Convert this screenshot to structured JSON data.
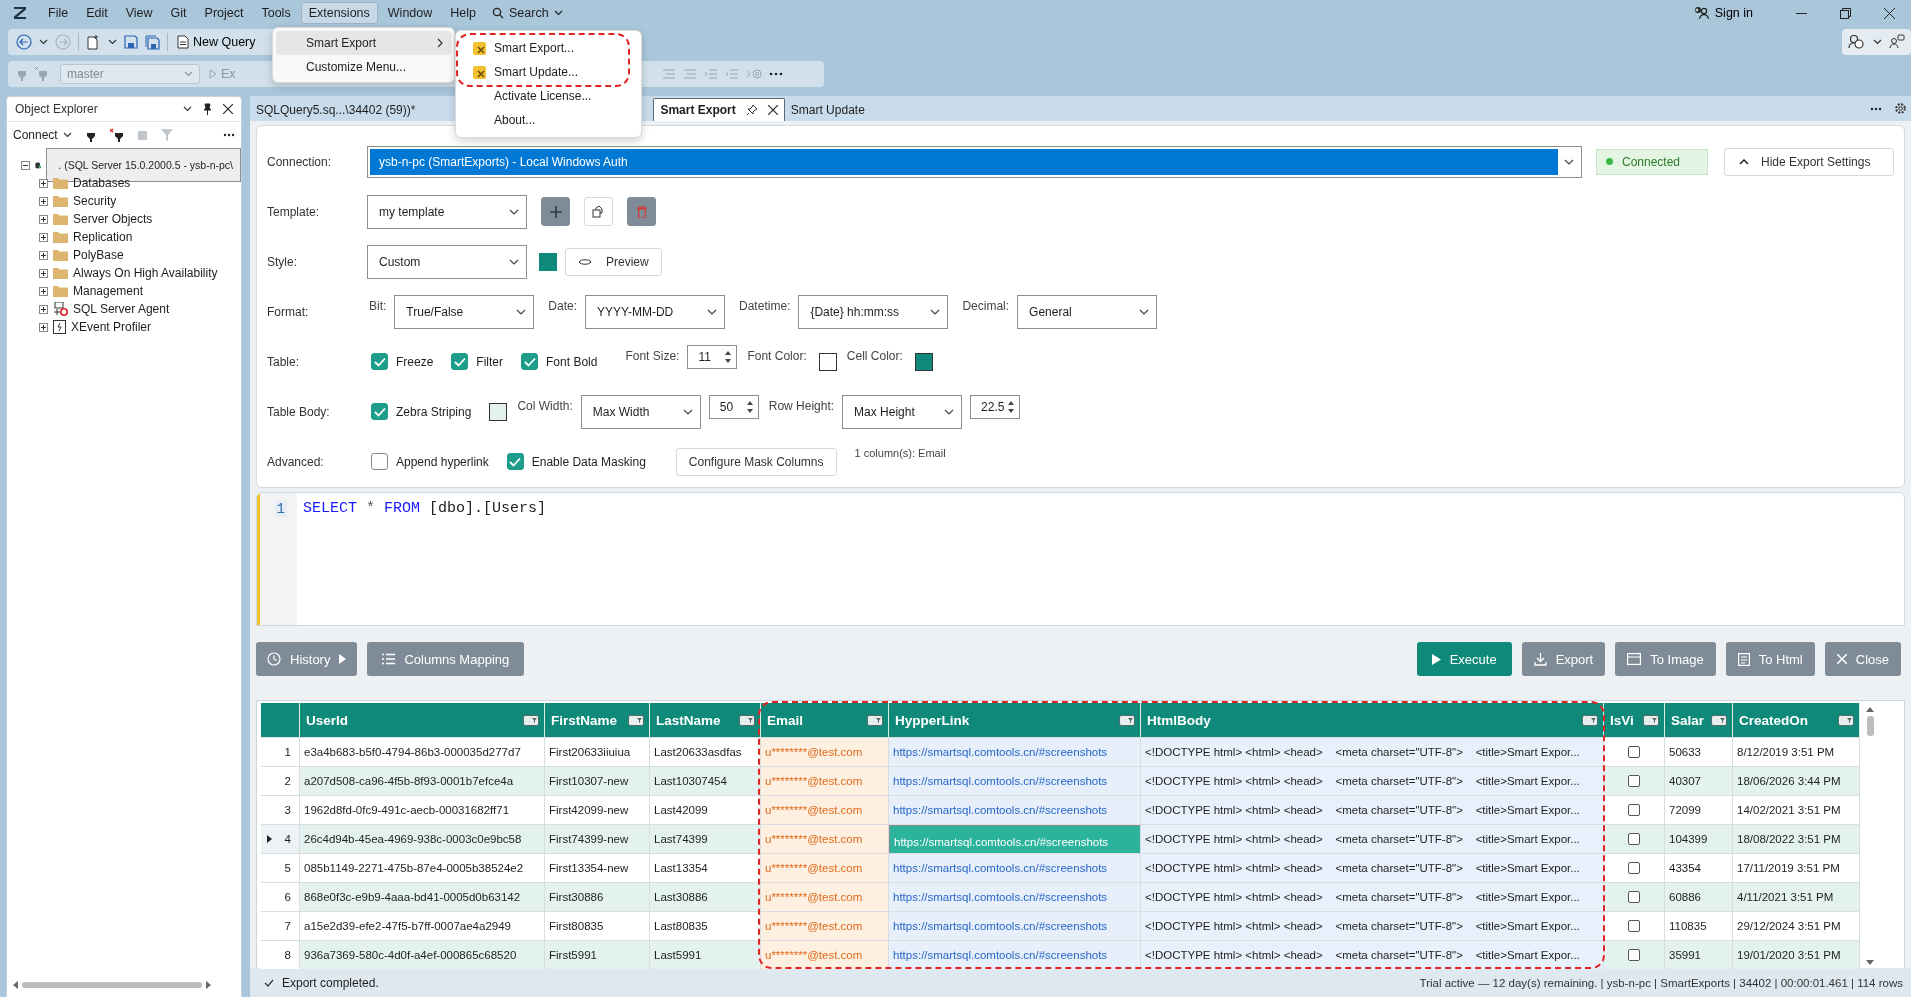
{
  "menu_bar": {
    "items": [
      {
        "label": "File",
        "selected": false
      },
      {
        "label": "Edit",
        "selected": false
      },
      {
        "label": "View",
        "selected": false
      },
      {
        "label": "Git",
        "selected": false
      },
      {
        "label": "Project",
        "selected": false
      },
      {
        "label": "Tools",
        "selected": false
      },
      {
        "label": "Extensions",
        "selected": true
      },
      {
        "label": "Window",
        "selected": false
      },
      {
        "label": "Help",
        "selected": false
      }
    ],
    "search": "Search",
    "sign_in": "Sign in"
  },
  "extensions_menu": {
    "items": [
      {
        "label": "Smart Export",
        "submenu": true,
        "selected": true
      },
      {
        "label": "Customize Menu...",
        "submenu": false,
        "selected": false
      }
    ]
  },
  "submenu": {
    "items": [
      {
        "label": "Smart Export...",
        "icon": true
      },
      {
        "label": "Smart Update...",
        "icon": true
      },
      {
        "label": "Activate License...",
        "icon": false
      },
      {
        "label": "About...",
        "icon": false
      }
    ]
  },
  "toolbar": {
    "new_query": "New Query",
    "database": "master",
    "execute": "Ex"
  },
  "object_explorer": {
    "title": "Object Explorer",
    "connect": "Connect",
    "tree": [
      {
        "label": ". (SQL Server 15.0.2000.5 - ysb-n-pc\\",
        "kind": "server",
        "selected": true,
        "expanded": true,
        "children": [
          {
            "label": "Databases",
            "kind": "folder",
            "selected": false,
            "expanded": false
          },
          {
            "label": "Security",
            "kind": "folder",
            "selected": false,
            "expanded": false
          },
          {
            "label": "Server Objects",
            "kind": "folder",
            "selected": false,
            "expanded": false
          },
          {
            "label": "Replication",
            "kind": "folder",
            "selected": false,
            "expanded": false
          },
          {
            "label": "PolyBase",
            "kind": "folder",
            "selected": false,
            "expanded": false
          },
          {
            "label": "Always On High Availability",
            "kind": "folder",
            "selected": false,
            "expanded": false
          },
          {
            "label": "Management",
            "kind": "folder",
            "selected": false,
            "expanded": false
          },
          {
            "label": "SQL Server Agent",
            "kind": "agent",
            "selected": false,
            "expanded": false
          },
          {
            "label": "XEvent Profiler",
            "kind": "profiler",
            "selected": false,
            "expanded": false
          }
        ]
      }
    ]
  },
  "doc_tabs": [
    {
      "label": "SQLQuery5.sq...\\34402 (59))*",
      "selected": false
    },
    {
      "label": "Smart Export",
      "selected": true
    },
    {
      "label": "Smart Update",
      "selected": false
    }
  ],
  "export_settings": {
    "connection": {
      "label": "Connection:",
      "value": "ysb-n-pc (SmartExports) - Local Windows Auth",
      "status": "Connected",
      "connected": true,
      "toggle": "Hide Export Settings"
    },
    "template": {
      "label": "Template:",
      "value": "my template"
    },
    "style": {
      "label": "Style:",
      "value": "Custom",
      "color": "#0f8a7a",
      "preview": "Preview"
    },
    "format": {
      "label": "Format:",
      "fields": [
        {
          "label": "Bit:",
          "value": "True/False"
        },
        {
          "label": "Date:",
          "value": "YYYY-MM-DD"
        },
        {
          "label": "Datetime:",
          "value": "{Date} hh:mm:ss"
        },
        {
          "label": "Decimal:",
          "value": "General"
        }
      ]
    },
    "table": {
      "label": "Table:",
      "options": [
        {
          "label": "Freeze",
          "checked": true
        },
        {
          "label": "Filter",
          "checked": true
        },
        {
          "label": "Font Bold",
          "checked": true
        }
      ],
      "font_size": {
        "label": "Font Size:",
        "value": "11"
      },
      "font_color": {
        "label": "Font Color:",
        "color": "#ffffff"
      },
      "cell_color": {
        "label": "Cell Color:",
        "color": "#0f8a7a"
      }
    },
    "table_body": {
      "label": "Table Body:",
      "zebra": {
        "label": "Zebra Striping",
        "checked": true,
        "color": "#e3f2ee"
      },
      "col_width": {
        "label": "Col Width:",
        "mode": "Max Width",
        "value": "50"
      },
      "row_height": {
        "label": "Row Height:",
        "mode": "Max Height",
        "value": "22.5"
      }
    },
    "advanced": {
      "label": "Advanced:",
      "options": [
        {
          "label": "Append hyperlink",
          "checked": false
        },
        {
          "label": "Enable Data Masking",
          "checked": true
        }
      ],
      "configure": "Configure Mask Columns",
      "note": "1 column(s): Email"
    }
  },
  "editor": {
    "line_numbers": [
      "1"
    ],
    "tokens": [
      {
        "text": "SELECT",
        "kind": "keyword"
      },
      {
        "text": " * ",
        "kind": "operator"
      },
      {
        "text": "FROM",
        "kind": "keyword"
      },
      {
        "text": " [dbo].[Users]",
        "kind": "plain"
      }
    ]
  },
  "left_actions": [
    {
      "label": "History",
      "kind": "history"
    },
    {
      "label": "Columns Mapping",
      "kind": "columns"
    }
  ],
  "right_actions": [
    {
      "label": "Execute",
      "kind": "execute"
    },
    {
      "label": "Export",
      "kind": "export"
    },
    {
      "label": "To Image",
      "kind": "image"
    },
    {
      "label": "To Html",
      "kind": "html"
    },
    {
      "label": "Close",
      "kind": "close"
    }
  ],
  "grid": {
    "columns": [
      {
        "label": "UserId",
        "kind": "text"
      },
      {
        "label": "FirstName",
        "kind": "text"
      },
      {
        "label": "LastName",
        "kind": "text"
      },
      {
        "label": "Email",
        "kind": "masked"
      },
      {
        "label": "HypperLink",
        "kind": "link"
      },
      {
        "label": "HtmlBody",
        "kind": "html"
      },
      {
        "label": "IsVi",
        "kind": "check"
      },
      {
        "label": "Salar",
        "kind": "text"
      },
      {
        "label": "CreatedOn",
        "kind": "text"
      }
    ],
    "rows": [
      {
        "number": "1",
        "current": false,
        "cells": [
          "e3a4b683-b5f0-4794-86b3-000035d277d7",
          "First20633iiuiua",
          "Last20633asdfas",
          "u********@test.com",
          "https://smartsql.comtools.cn/#screenshots",
          "<!DOCTYPE html> <html> <head>    <meta charset=\"UTF-8\">    <title>Smart Expor...",
          false,
          "50633",
          "8/12/2019 3:51 PM"
        ]
      },
      {
        "number": "2",
        "current": false,
        "cells": [
          "a207d508-ca96-4f5b-8f93-0001b7efce4a",
          "First10307-new",
          "Last10307454",
          "u********@test.com",
          "https://smartsql.comtools.cn/#screenshots",
          "<!DOCTYPE html> <html> <head>    <meta charset=\"UTF-8\">    <title>Smart Expor...",
          false,
          "40307",
          "18/06/2026 3:44 PM"
        ]
      },
      {
        "number": "3",
        "current": false,
        "cells": [
          "1962d8fd-0fc9-491c-aecb-00031682ff71",
          "First42099-new",
          "Last42099",
          "u********@test.com",
          "https://smartsql.comtools.cn/#screenshots",
          "<!DOCTYPE html> <html> <head>    <meta charset=\"UTF-8\">    <title>Smart Expor...",
          false,
          "72099",
          "14/02/2021 3:51 PM"
        ]
      },
      {
        "number": "4",
        "current": true,
        "cells": [
          "26c4d94b-45ea-4969-938c-0003c0e9bc58",
          "First74399-new",
          "Last74399",
          "u********@test.com",
          "https://smartsql.comtools.cn/#screenshots",
          "<!DOCTYPE html> <html> <head>    <meta charset=\"UTF-8\">    <title>Smart Expor...",
          false,
          "104399",
          "18/08/2022 3:51 PM"
        ]
      },
      {
        "number": "5",
        "current": false,
        "cells": [
          "085b1149-2271-475b-87e4-0005b38524e2",
          "First13354-new",
          "Last13354",
          "u********@test.com",
          "https://smartsql.comtools.cn/#screenshots",
          "<!DOCTYPE html> <html> <head>    <meta charset=\"UTF-8\">    <title>Smart Expor...",
          false,
          "43354",
          "17/11/2019 3:51 PM"
        ]
      },
      {
        "number": "6",
        "current": false,
        "cells": [
          "868e0f3c-e9b9-4aaa-bd41-0005d0b63142",
          "First30886",
          "Last30886",
          "u********@test.com",
          "https://smartsql.comtools.cn/#screenshots",
          "<!DOCTYPE html> <html> <head>    <meta charset=\"UTF-8\">    <title>Smart Expor...",
          false,
          "60886",
          "4/11/2021 3:51 PM"
        ]
      },
      {
        "number": "7",
        "current": false,
        "cells": [
          "a15e2d39-efe2-47f5-b7ff-0007ae4a2949",
          "First80835",
          "Last80835",
          "u********@test.com",
          "https://smartsql.comtools.cn/#screenshots",
          "<!DOCTYPE html> <html> <head>    <meta charset=\"UTF-8\">    <title>Smart Expor...",
          false,
          "110835",
          "29/12/2024 3:51 PM"
        ]
      },
      {
        "number": "8",
        "current": false,
        "cells": [
          "936a7369-580c-4d0f-a4ef-000865c68520",
          "First5991",
          "Last5991",
          "u********@test.com",
          "https://smartsql.comtools.cn/#screenshots",
          "<!DOCTYPE html> <html> <head>    <meta charset=\"UTF-8\">    <title>Smart Expor...",
          false,
          "35991",
          "19/01/2020 3:51 PM"
        ]
      }
    ]
  },
  "status_bar": {
    "message": "Export completed.",
    "info": "Trial active — 12 day(s) remaining. | ysb-n-pc | SmartExports | 34402 | 00:00:01.461 | 114 rows"
  }
}
